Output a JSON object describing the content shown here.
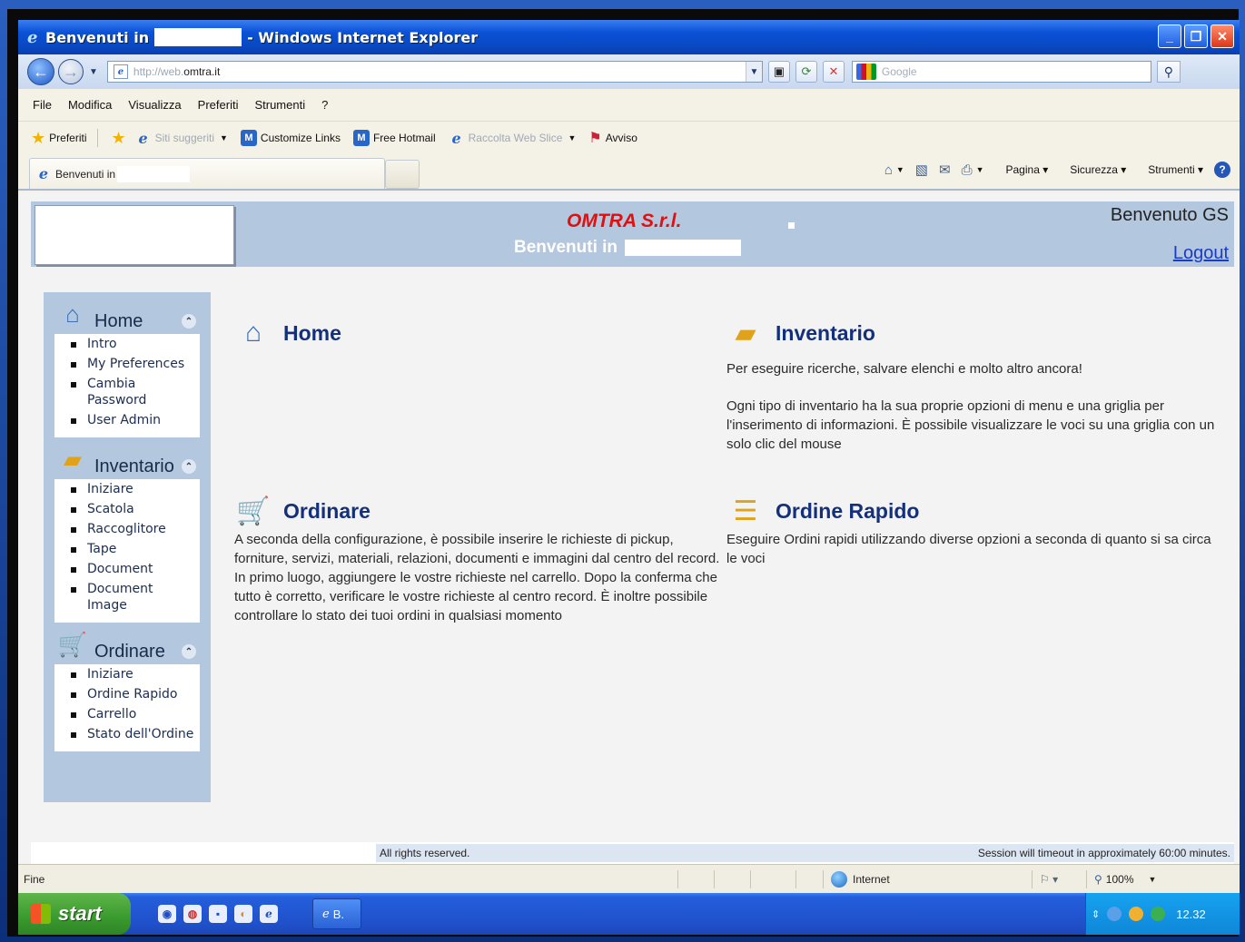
{
  "window": {
    "title_prefix": "Benvenuti in",
    "title_suffix": " - Windows Internet Explorer",
    "buttons": {
      "minimize": "_",
      "maximize": "❐",
      "close": "✕"
    }
  },
  "address": {
    "url_grey": "http://web.",
    "url_dark": "omtra.it",
    "search_placeholder": "Google"
  },
  "menu": [
    "File",
    "Modifica",
    "Visualizza",
    "Preferiti",
    "Strumenti",
    "?"
  ],
  "favorites": {
    "favorites_label": "Preferiti",
    "items": [
      {
        "label": "Siti suggeriti",
        "dimmed": true
      },
      {
        "label": "Customize Links",
        "dimmed": false
      },
      {
        "label": "Free Hotmail",
        "dimmed": false
      },
      {
        "label": "Raccolta Web Slice",
        "dimmed": true
      },
      {
        "label": "Avviso",
        "dimmed": false
      }
    ]
  },
  "tab": {
    "label": "Benvenuti in"
  },
  "commandbar": {
    "page": "Pagina",
    "security": "Sicurezza",
    "tools": "Strumenti",
    "help": "?"
  },
  "header": {
    "company": "OMTRA S.r.l.",
    "welcome": "Benvenuti in",
    "greeting": "Benvenuto GS",
    "logout": "Logout"
  },
  "sidebar": {
    "sections": [
      {
        "title": "Home",
        "icon": "home-icon",
        "items": [
          "Intro",
          "My Preferences",
          "Cambia Password",
          "User Admin"
        ]
      },
      {
        "title": "Inventario",
        "icon": "box-icon",
        "items": [
          "Iniziare",
          "Scatola",
          "Raccoglitore",
          "Tape",
          "Document",
          "Document Image"
        ]
      },
      {
        "title": "Ordinare",
        "icon": "cart-icon",
        "items": [
          "Iniziare",
          "Ordine Rapido",
          "Carrello",
          "Stato dell'Ordine"
        ]
      }
    ]
  },
  "panels": {
    "home": {
      "title": "Home",
      "text": ""
    },
    "inventario": {
      "title": "Inventario",
      "text1": "Per eseguire ricerche, salvare elenchi e molto altro ancora!",
      "text2": "Ogni tipo di inventario ha la sua proprie opzioni di menu e una griglia per l'inserimento di informazioni. È possibile visualizzare le voci su una griglia con un solo clic del mouse"
    },
    "ordinare": {
      "title": "Ordinare",
      "text": "A seconda della configurazione, è possibile inserire le richieste di pickup, forniture, servizi, materiali, relazioni, documenti e immagini dal centro del record. In primo luogo, aggiungere le vostre richieste nel carrello. Dopo la conferma che tutto è corretto, verificare le vostre richieste al centro record. È inoltre possibile controllare lo stato dei tuoi ordini in qualsiasi momento"
    },
    "ordine_rapido": {
      "title": "Ordine Rapido",
      "text": "Eseguire  Ordini rapidi utilizzando diverse opzioni a seconda di quanto si sa circa le voci"
    }
  },
  "footer": {
    "rights": "All rights reserved.",
    "session": "Session will timeout in approximately 60:00 minutes."
  },
  "status": {
    "left": "Fine",
    "zone": "Internet",
    "zoom": "100%"
  },
  "taskbar": {
    "start": "start",
    "task_label": "B.",
    "clock": "12.32"
  }
}
